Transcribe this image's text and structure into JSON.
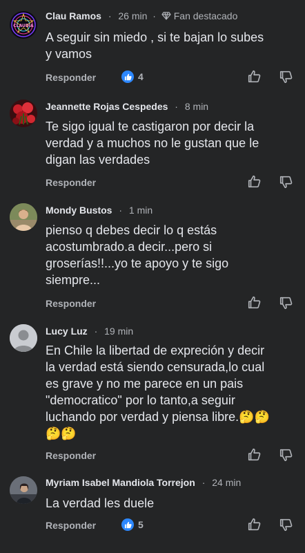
{
  "comments": [
    {
      "author": "Clau Ramos",
      "time": "26 min",
      "badge": "Fan destacado",
      "avatar_text": "CLAUDIA",
      "lines": [
        "A seguir sin miedo , si te bajan lo subes",
        "y vamos"
      ],
      "reply": "Responder",
      "reactions": "4"
    },
    {
      "author": "Jeannette Rojas Cespedes",
      "time": "8 min",
      "lines": [
        "Te sigo igual te castigaron por decir la",
        "verdad y a muchos no le gustan que le",
        "digan las verdades"
      ],
      "reply": "Responder"
    },
    {
      "author": "Mondy Bustos",
      "time": "1 min",
      "lines": [
        "pienso q debes decir lo q estás",
        "acostumbrado.a decir...pero si",
        "groserías!!...yo te apoyo y te sigo",
        "siempre..."
      ],
      "reply": "Responder"
    },
    {
      "author": "Lucy Luz",
      "time": "19 min",
      "lines": [
        "En Chile la libertad de expreción y decir",
        "la verdad está siendo censurada,lo cual",
        "es grave y no me parece en un pais",
        "\"democratico\" por lo tanto,a seguir",
        "luchando por verdad y piensa libre.🤔🤔",
        "🤔🤔"
      ],
      "reply": "Responder"
    },
    {
      "author": "Myriam Isabel Mandiola Torrejon",
      "time": "24 min",
      "lines": [
        "La verdad les duele"
      ],
      "reply": "Responder",
      "reactions": "5"
    }
  ],
  "separator": "·",
  "icons": {
    "like": "thumbs-up-icon",
    "dislike": "thumbs-down-icon",
    "badge": "diamond-icon"
  },
  "colors": {
    "background": "#242526",
    "text": "#e4e6eb",
    "secondary": "#b0b3b8",
    "like_blue": "#2d88ff"
  }
}
